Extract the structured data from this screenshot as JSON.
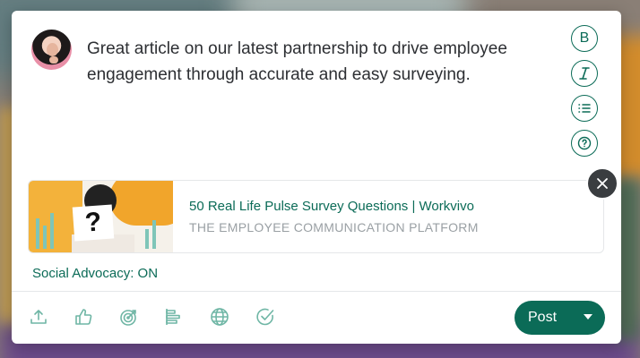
{
  "composer": {
    "text": "Great article on our latest partnership to drive employee engagement through accurate and easy surveying.",
    "format_tools": [
      {
        "name": "bold",
        "icon": "bold-icon",
        "glyph": "B"
      },
      {
        "name": "italic",
        "icon": "italic-icon"
      },
      {
        "name": "list",
        "icon": "list-icon"
      },
      {
        "name": "help",
        "icon": "help-icon"
      }
    ]
  },
  "link_preview": {
    "title": "50 Real Life Pulse Survey Questions | Workvivo",
    "subtitle": "THE EMPLOYEE COMMUNICATION PLATFORM",
    "thumbnail_icon": "question-mark-sign-image"
  },
  "advocacy": {
    "label": "Social Advocacy: ON"
  },
  "toolbar": {
    "items": [
      "upload-icon",
      "thumbs-up-icon",
      "target-icon",
      "align-left-icon",
      "globe-icon",
      "check-circle-icon"
    ],
    "post_label": "Post"
  },
  "colors": {
    "accent": "#0b6b57",
    "text": "#2d2f33",
    "muted": "#9aa0a4"
  }
}
